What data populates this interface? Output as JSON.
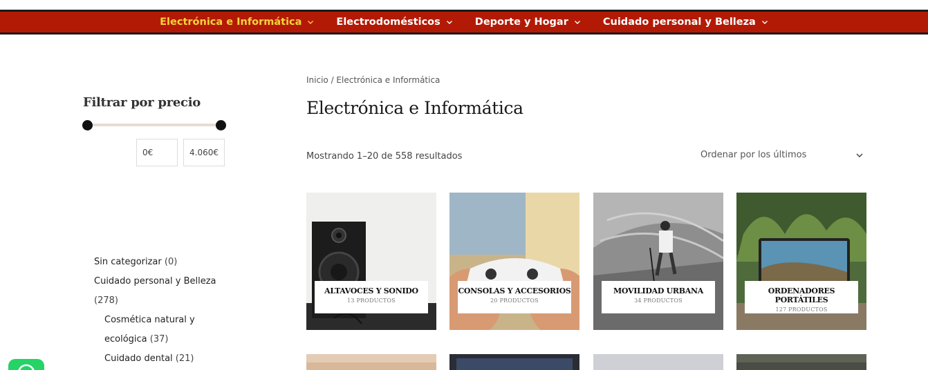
{
  "nav": {
    "items": [
      {
        "label": "Electrónica e Informática",
        "active": true
      },
      {
        "label": "Electrodomésticos",
        "active": false
      },
      {
        "label": "Deporte y Hogar",
        "active": false
      },
      {
        "label": "Cuidado personal y Belleza",
        "active": false
      }
    ]
  },
  "sidebar": {
    "filter_title": "Filtrar por precio",
    "price_min": "0€",
    "price_max": "4.060€",
    "categories": [
      {
        "label": "Sin categorizar",
        "count": "(0)"
      },
      {
        "label": "Cuidado personal y Belleza",
        "count": "(278)"
      },
      {
        "label": "Cosmética natural y ecológica",
        "count": "(37)"
      },
      {
        "label": "Cuidado dental",
        "count": "(21)"
      }
    ]
  },
  "main": {
    "breadcrumb": "Inicio / Electrónica e Informática",
    "title": "Electrónica e Informática",
    "result_count": "Mostrando 1–20 de 558 resultados",
    "orderby": "Ordenar por los últimos",
    "categories": [
      {
        "name": "ALTAVOCES Y SONIDO",
        "count": "13 PRODUCTOS"
      },
      {
        "name": "CONSOLAS Y ACCESORIOS",
        "count": "20 PRODUCTOS"
      },
      {
        "name": "MOVILIDAD URBANA",
        "count": "34 PRODUCTOS"
      },
      {
        "name": "ORDENADORES PORTÁTILES",
        "count": "127 PRODUCTOS"
      }
    ]
  },
  "colors": {
    "nav_bg": "#b31a05",
    "nav_active": "#f6d33d",
    "whatsapp": "#25d366"
  }
}
